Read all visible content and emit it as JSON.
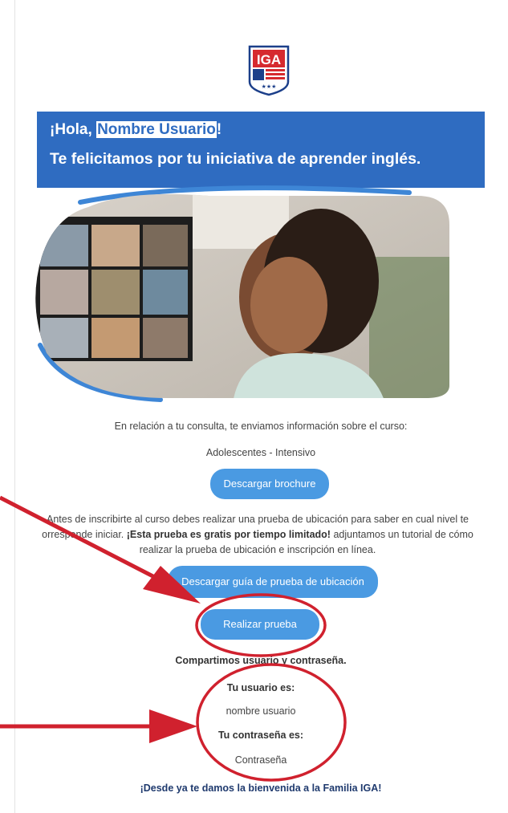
{
  "logo": {
    "text": "IGA"
  },
  "banner": {
    "greeting_prefix": "¡Hola, ",
    "user_name": "Nombre Usuario",
    "greeting_suffix": "!",
    "congrats": "Te felicitamos por tu iniciativa de aprender inglés."
  },
  "body": {
    "intro": "En relación a tu consulta, te enviamos información sobre el curso:",
    "course_name": "Adolescentes - Intensivo",
    "brochure_button": "Descargar brochure",
    "placement_line1": "Antes de inscribirte al curso debes realizar una prueba de ubicación para saber en cual nivel te",
    "placement_line2_pre": "orresponde iniciar. ",
    "placement_bold": "¡Esta prueba es gratis por tiempo limitado!",
    "placement_line2_post": " adjuntamos un tutorial de cómo",
    "placement_line3": "realizar la prueba de ubicación e inscripción en línea.",
    "guide_button": "Descargar guía de prueba de ubicación",
    "test_button": "Realizar prueba",
    "share_credentials": "Compartimos usuario y contraseña.",
    "user_label": "Tu usuario es:",
    "user_value": "nombre usuario",
    "password_label": "Tu contraseña es:",
    "password_value": "Contraseña",
    "welcome": "¡Desde ya te damos la bienvenida a la Familia IGA!"
  },
  "colors": {
    "banner": "#2f6cc1",
    "button": "#4a9ae2",
    "annotation": "#d0212e",
    "welcome_text": "#1f3a6e"
  }
}
